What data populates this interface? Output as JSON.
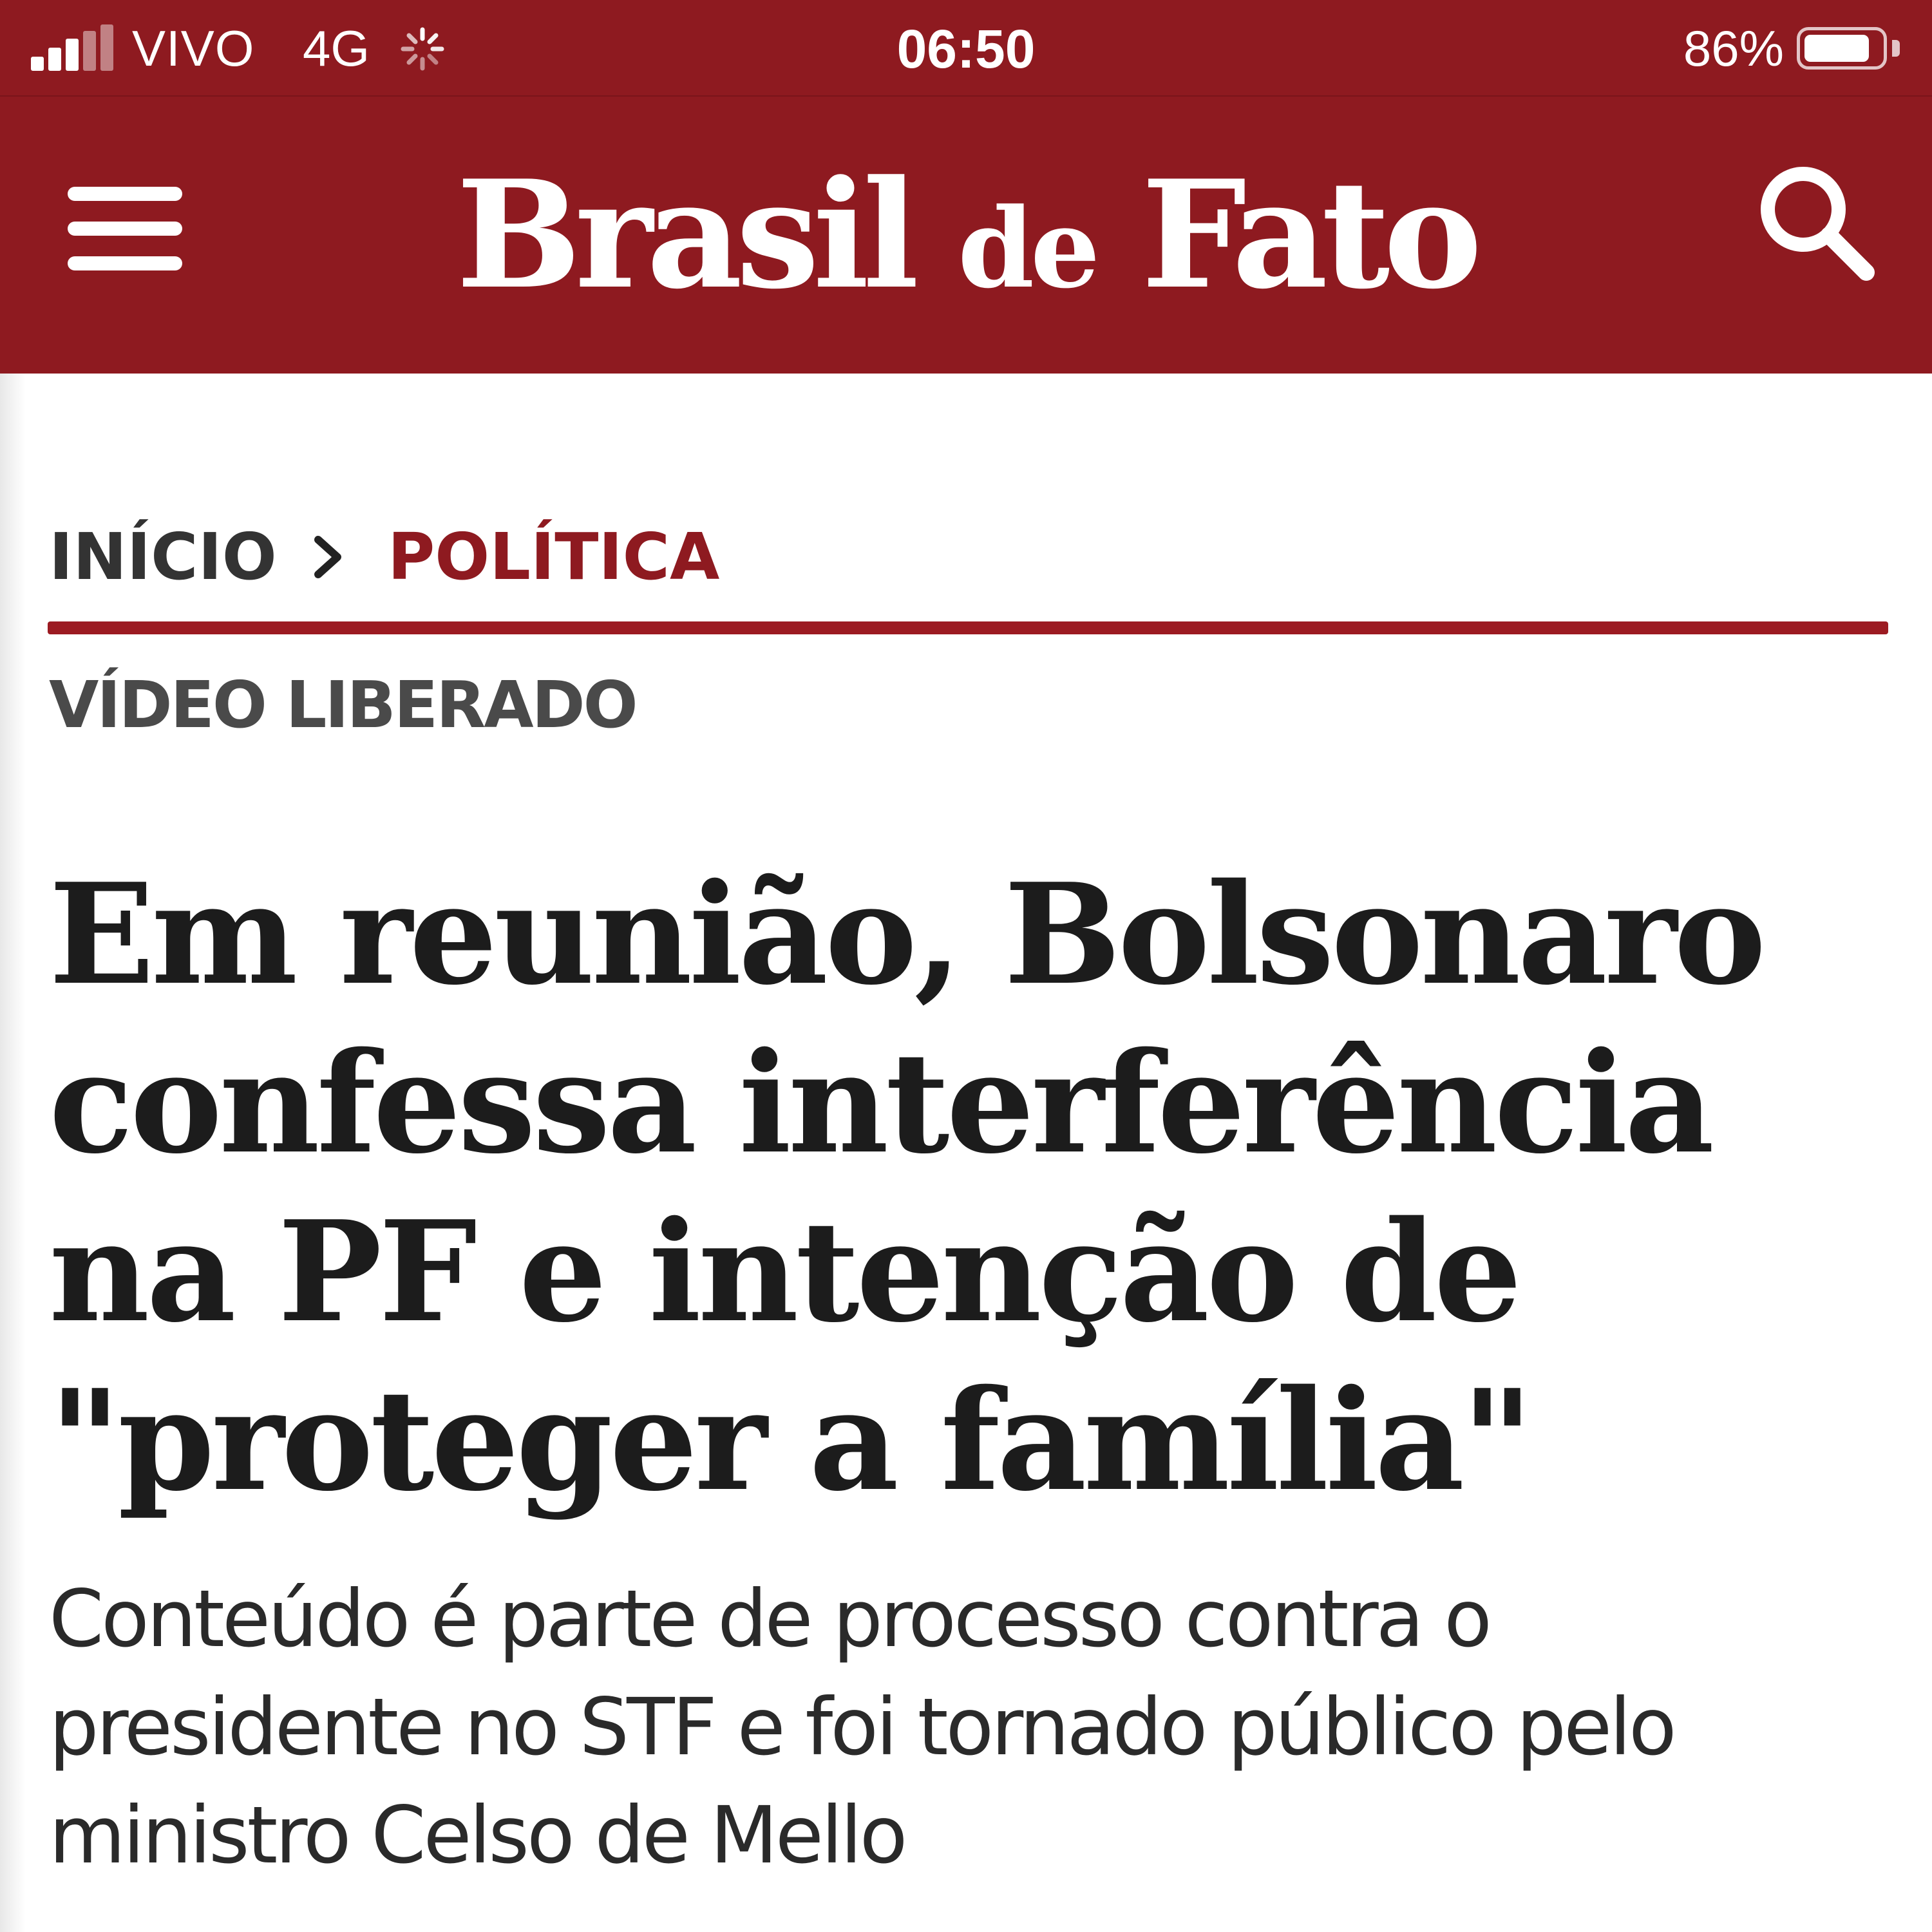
{
  "status_bar": {
    "carrier": "VIVO",
    "network": "4G",
    "time": "06:50",
    "battery_percent_label": "86%",
    "battery_level": 0.86,
    "signal_bars_active": 3,
    "signal_bars_total": 5
  },
  "header": {
    "logo_part1": "Brasil",
    "logo_part2": "de",
    "logo_part3": "Fato",
    "menu_icon": "hamburger-menu-icon",
    "search_icon": "search-icon"
  },
  "breadcrumb": {
    "home": "INÍCIO",
    "separator_icon": "chevron-right-icon",
    "current": "POLÍTICA"
  },
  "article": {
    "kicker": "VÍDEO LIBERADO",
    "headline": "Em reunião, Bolsonaro confessa interferência na PF e intenção de \"proteger a família\"",
    "subtitle": "Conteúdo é parte de processo contra o presidente no STF e foi tornado público pelo ministro Celso de Mello"
  },
  "colors": {
    "brand": "#8e1a20",
    "rule": "#9c1b22",
    "text_dark": "#1c1c1c",
    "text_muted": "#4a4a4a"
  }
}
